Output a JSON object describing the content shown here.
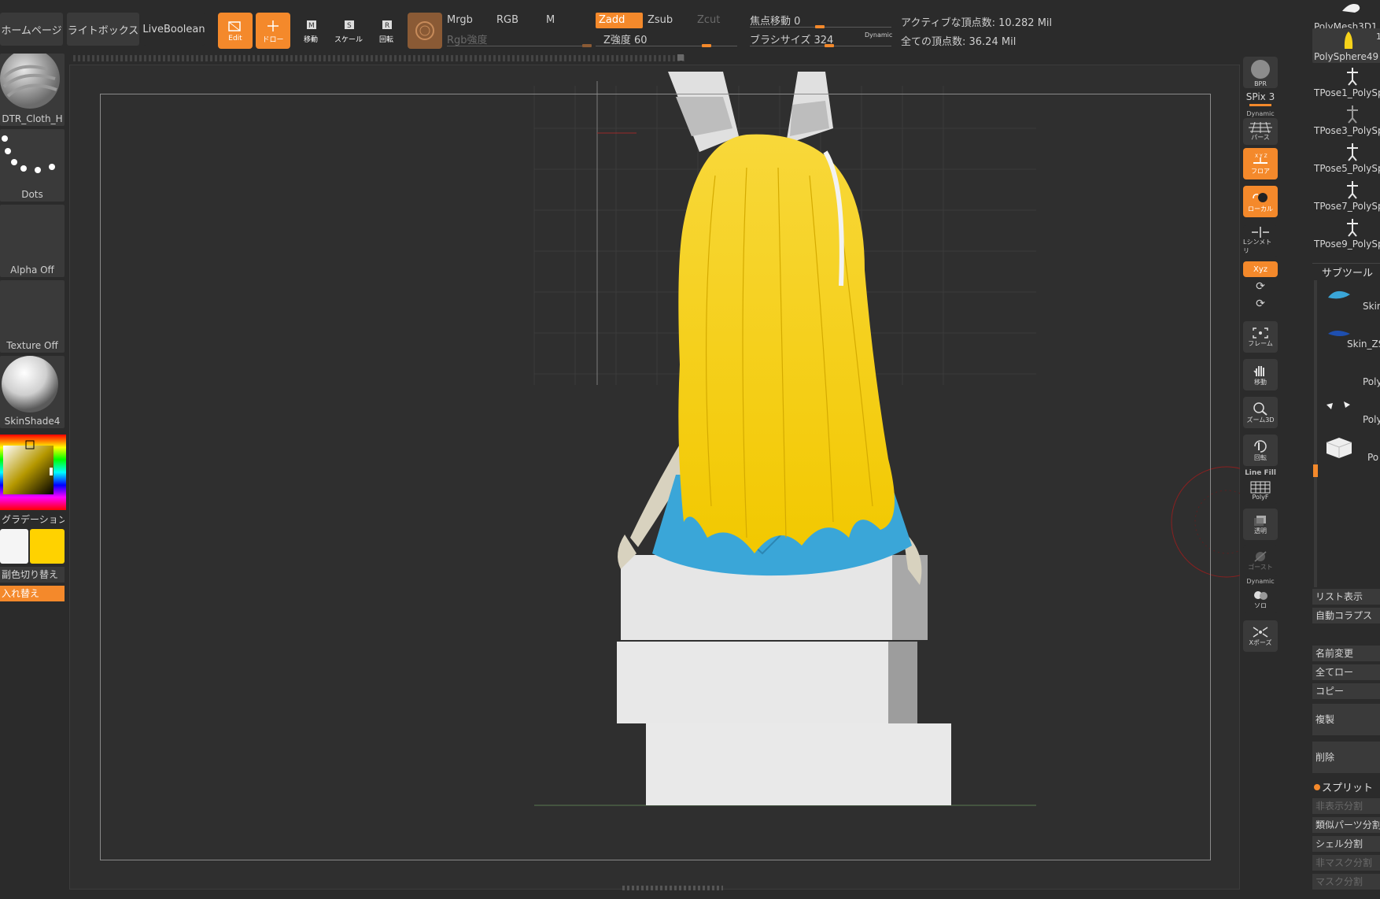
{
  "topbar": {
    "home": "ホームページ",
    "lightbox": "ライトボックス",
    "liveboolean": "LiveBoolean",
    "edit": "Edit",
    "draw": "ドロー",
    "move": "移動",
    "scale": "スケール",
    "rotate": "回転",
    "mrgb": "Mrgb",
    "rgb": "RGB",
    "m": "M",
    "zadd": "Zadd",
    "zsub": "Zsub",
    "zcut": "Zcut",
    "rgb_intensity": "Rgb強度",
    "z_intensity": "Z強度 60",
    "focal_shift": "焦点移動 0",
    "brush_size": "ブラシサイズ 324",
    "dynamic": "Dynamic",
    "active_points": "アクティブな頂点数: 10.282 Mil",
    "total_points": "全ての頂点数: 36.24 Mil"
  },
  "left": {
    "brush": "DTR_Cloth_H",
    "stroke": "Dots",
    "alpha": "Alpha Off",
    "texture": "Texture Off",
    "material": "SkinShade4",
    "gradient": "グラデーション",
    "switch_color": "副色切り替え",
    "swap": "入れ替え"
  },
  "rightcol": {
    "bpr": "BPR",
    "spix": "SPix 3",
    "dynamic": "Dynamic",
    "persp": "パース",
    "floor": "フロア",
    "local": "ローカル",
    "symmetry": "Lシンメトリ",
    "xyz": "Xyz",
    "frame": "フレーム",
    "move": "移動",
    "zoom3d": "ズーム3D",
    "rotate": "回転",
    "linefill": "Line Fill",
    "polyf": "PolyF",
    "transp": "透明",
    "ghost": "ゴースト",
    "dynamic2": "Dynamic",
    "solo": "ソロ",
    "xpose": "Xポーズ"
  },
  "rpanel": {
    "tools": [
      "PolyMesh3D1",
      "PolySphere49",
      "TPose1_PolySp",
      "TPose3_PolySp",
      "TPose5_PolySp",
      "TPose7_PolySp",
      "TPose9_PolySp"
    ],
    "subtool_header": "サブツール",
    "subtools": [
      "Skin",
      "Skin_ZS",
      "Poly",
      "Poly",
      "Po"
    ],
    "list_display": "リスト表示",
    "auto_collapse": "自動コラプス",
    "rename": "名前変更",
    "all_low": "全てロー",
    "copy": "コピー",
    "duplicate": "複製",
    "delete": "削除",
    "split": "スプリット",
    "split_hidden": "非表示分割",
    "split_similar": "類似パーツ分割",
    "split_shell": "シェル分割",
    "split_unmasked": "非マスク分割",
    "split_masked": "マスク分割",
    "count_1": "1"
  },
  "colors": {
    "accent": "#f4892b",
    "hair": "#f6d21a",
    "skirt": "#3aa6d8",
    "secondary_color": "#ffd200"
  }
}
